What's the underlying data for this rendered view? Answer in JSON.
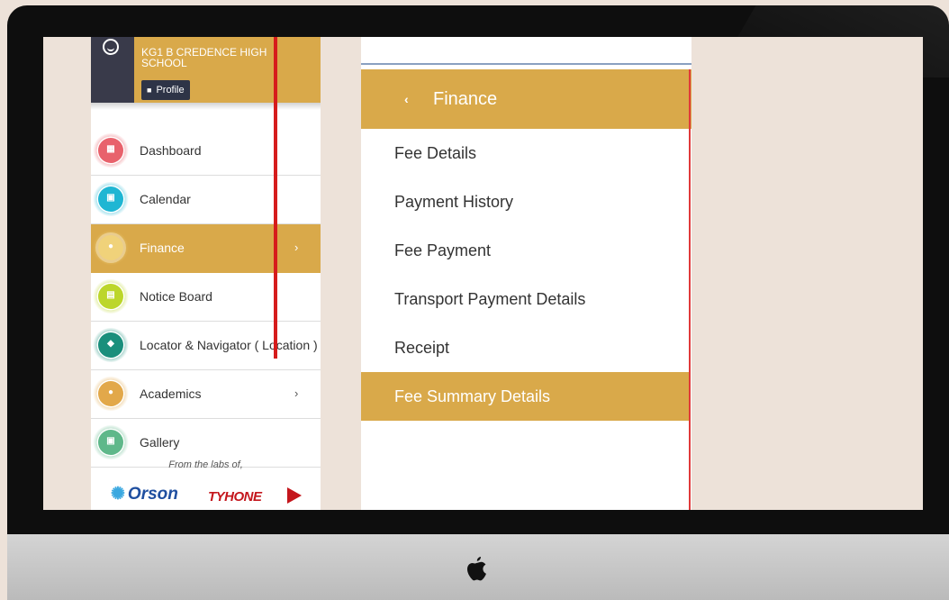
{
  "colors": {
    "accent": "#d9a94a",
    "header_dark": "#393a4a",
    "red_line": "#d61c1c"
  },
  "sidebar": {
    "school_name": "KG1 B   CREDENCE HIGH SCHOOL",
    "profile_label": "Profile",
    "items": [
      {
        "label": "Dashboard",
        "icon": "dashboard-icon",
        "color": "#e8626c",
        "glyph": "▦",
        "active": false,
        "chevron": ""
      },
      {
        "label": "Calendar",
        "icon": "calendar-icon",
        "color": "#1fb6d3",
        "glyph": "▣",
        "active": false,
        "chevron": ""
      },
      {
        "label": "Finance",
        "icon": "finance-icon",
        "color": "#f0d27a",
        "glyph": "●",
        "active": true,
        "chevron": "›"
      },
      {
        "label": "Notice Board",
        "icon": "notice-board-icon",
        "color": "#bcd62b",
        "glyph": "▤",
        "active": false,
        "chevron": ""
      },
      {
        "label": "Locator & Navigator ( Location )",
        "icon": "location-pin-icon",
        "color": "#1a8f7c",
        "glyph": "◆",
        "active": false,
        "chevron": ""
      },
      {
        "label": "Academics",
        "icon": "academics-icon",
        "color": "#e2a84a",
        "glyph": "●",
        "active": false,
        "chevron": "›"
      },
      {
        "label": "Gallery",
        "icon": "gallery-icon",
        "color": "#5fb88a",
        "glyph": "▣",
        "active": false,
        "chevron": ""
      }
    ],
    "footer_text": "From the labs of,",
    "logo_orson": "Orson",
    "logo_tyhone": "TYHONE"
  },
  "panel": {
    "back_icon": "‹",
    "title": "Finance",
    "items": [
      {
        "label": "Fee Details",
        "active": false
      },
      {
        "label": "Payment History",
        "active": false
      },
      {
        "label": "Fee Payment",
        "active": false
      },
      {
        "label": "Transport Payment Details",
        "active": false
      },
      {
        "label": "Receipt",
        "active": false
      },
      {
        "label": "Fee Summary Details",
        "active": true
      }
    ]
  }
}
